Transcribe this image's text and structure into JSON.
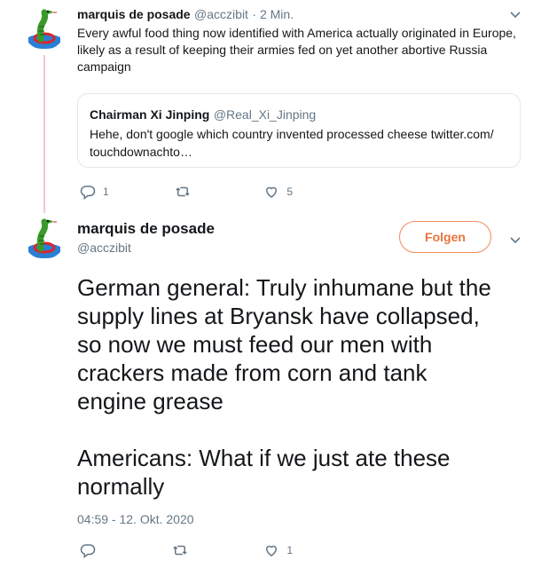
{
  "tweet1": {
    "name": "marquis de posade",
    "handle": "@acczibit",
    "time": "· 2 Min.",
    "text": "Every awful food thing now identified with America actually originated in Europe, likely as a result of keeping their armies fed on yet another abortive Russia campaign",
    "quote": {
      "name": "Chairman Xi Jinping",
      "handle": "@Real_Xi_Jinping",
      "text_line1": "Hehe, don't google which country invented processed cheese twitter.com/",
      "text_line2": "touchdownachto…"
    },
    "actions": {
      "reply_count": "1",
      "retweet_count": "",
      "like_count": "5"
    }
  },
  "tweet2": {
    "name": "marquis de posade",
    "handle": "@acczibit",
    "follow_label": "Folgen",
    "text_lines": [
      "German general: Truly inhumane but the",
      "supply lines at Bryansk have collapsed,",
      "so now we must feed our men with",
      "crackers made from corn and tank",
      "engine grease"
    ],
    "text2_lines": [
      "Americans: What if we just ate these",
      "normally"
    ],
    "timestamp": "04:59 - 12. Okt. 2020",
    "actions": {
      "reply_count": "",
      "retweet_count": "",
      "like_count": "1"
    }
  },
  "colors": {
    "accent": "#e8743b",
    "thread_line": "#f3c6cc",
    "secondary_text": "#657786"
  },
  "icons": [
    "chevron-down-icon",
    "reply-icon",
    "retweet-icon",
    "like-icon",
    "avatar-snake"
  ]
}
